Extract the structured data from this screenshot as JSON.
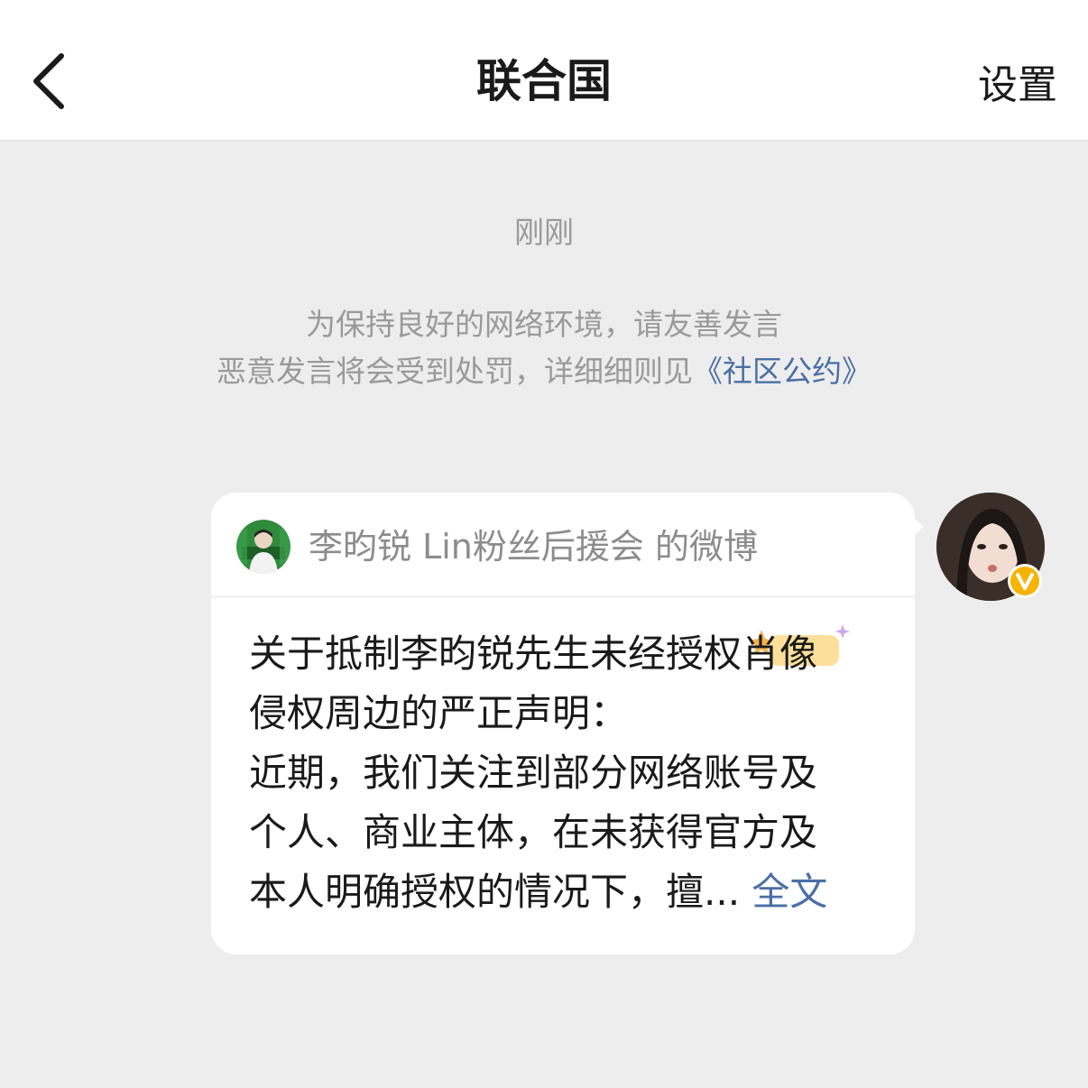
{
  "header": {
    "title": "联合国",
    "settings_label": "设置"
  },
  "chat": {
    "timestamp": "刚刚",
    "notice_line1": "为保持良好的网络环境，请友善发言",
    "notice_line2_prefix": "恶意发言将会受到处罚，详细细则见",
    "notice_link": "《社区公约》"
  },
  "card": {
    "source": "李昀锐 Lin粉丝后援会 的微博",
    "lines": [
      "关于抵制李昀锐先生未经授权肖像",
      "侵权周边的严正声明：",
      "近期，我们关注到部分网络账号及",
      "个人、商业主体，在未获得官方及",
      "本人明确授权的情况下，擅..."
    ],
    "more_label": "全文"
  },
  "colors": {
    "background": "#ededed",
    "link": "#4a6fa5",
    "badge": "#f5b400"
  }
}
